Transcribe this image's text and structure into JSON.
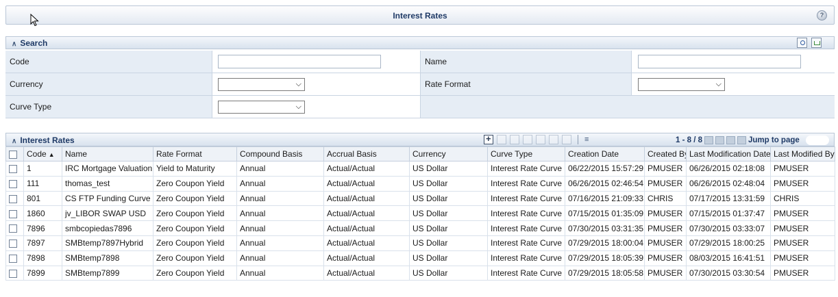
{
  "window": {
    "title": "Interest Rates",
    "help_icon": "help-icon"
  },
  "search": {
    "section_title": "Search",
    "fields": {
      "code_label": "Code",
      "code_value": "",
      "name_label": "Name",
      "name_value": "",
      "currency_label": "Currency",
      "currency_value": "",
      "rate_format_label": "Rate Format",
      "rate_format_value": "",
      "curve_type_label": "Curve Type",
      "curve_type_value": ""
    }
  },
  "grid": {
    "section_title": "Interest Rates",
    "pager_text": "1 - 8 / 8",
    "jump_label": "Jump to page",
    "columns": [
      "Code",
      "Name",
      "Rate Format",
      "Compound Basis",
      "Accrual Basis",
      "Currency",
      "Curve Type",
      "Creation Date",
      "Created By",
      "Last Modification Date",
      "Last Modified By"
    ],
    "rows": [
      [
        "1",
        "IRC Mortgage Valuation",
        "Yield to Maturity",
        "Annual",
        "Actual/Actual",
        "US Dollar",
        "Interest Rate Curve",
        "06/22/2015 15:57:29",
        "PMUSER",
        "06/26/2015 02:18:08",
        "PMUSER"
      ],
      [
        "111",
        "thomas_test",
        "Zero Coupon Yield",
        "Annual",
        "Actual/Actual",
        "US Dollar",
        "Interest Rate Curve",
        "06/26/2015 02:46:54",
        "PMUSER",
        "06/26/2015 02:48:04",
        "PMUSER"
      ],
      [
        "801",
        "CS FTP Funding Curve",
        "Zero Coupon Yield",
        "Annual",
        "Actual/Actual",
        "US Dollar",
        "Interest Rate Curve",
        "07/16/2015 21:09:33",
        "CHRIS",
        "07/17/2015 13:31:59",
        "CHRIS"
      ],
      [
        "1860",
        "jv_LIBOR SWAP USD",
        "Zero Coupon Yield",
        "Annual",
        "Actual/Actual",
        "US Dollar",
        "Interest Rate Curve",
        "07/15/2015 01:35:09",
        "PMUSER",
        "07/15/2015 01:37:47",
        "PMUSER"
      ],
      [
        "7896",
        "smbcopiedas7896",
        "Zero Coupon Yield",
        "Annual",
        "Actual/Actual",
        "US Dollar",
        "Interest Rate Curve",
        "07/30/2015 03:31:35",
        "PMUSER",
        "07/30/2015 03:33:07",
        "PMUSER"
      ],
      [
        "7897",
        "SMBtemp7897Hybrid",
        "Zero Coupon Yield",
        "Annual",
        "Actual/Actual",
        "US Dollar",
        "Interest Rate Curve",
        "07/29/2015 18:00:04",
        "PMUSER",
        "07/29/2015 18:00:25",
        "PMUSER"
      ],
      [
        "7898",
        "SMBtemp7898",
        "Zero Coupon Yield",
        "Annual",
        "Actual/Actual",
        "US Dollar",
        "Interest Rate Curve",
        "07/29/2015 18:05:39",
        "PMUSER",
        "08/03/2015 16:41:51",
        "PMUSER"
      ],
      [
        "7899",
        "SMBtemp7899",
        "Zero Coupon Yield",
        "Annual",
        "Actual/Actual",
        "US Dollar",
        "Interest Rate Curve",
        "07/29/2015 18:05:58",
        "PMUSER",
        "07/30/2015 03:30:54",
        "PMUSER"
      ]
    ]
  }
}
